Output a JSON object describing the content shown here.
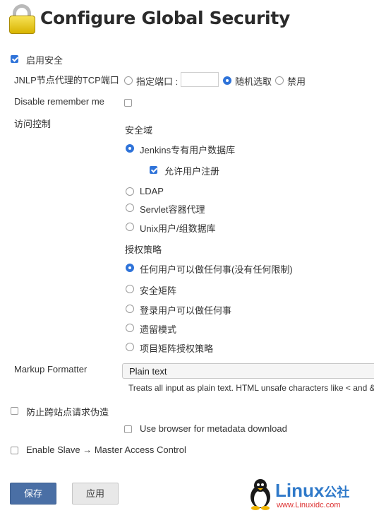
{
  "page": {
    "title": "Configure Global Security"
  },
  "enable_security": {
    "label": "启用安全",
    "checked": true
  },
  "jnlp": {
    "label": "JNLP节点代理的TCP端口",
    "options": [
      "指定端口 :",
      "随机选取",
      "禁用"
    ],
    "selected": "随机选取",
    "port_value": ""
  },
  "remember_me": {
    "label": "Disable remember me",
    "checked": false
  },
  "access_control": {
    "label": "访问控制",
    "realm": {
      "heading": "安全域",
      "options": [
        "Jenkins专有用户数据库",
        "LDAP",
        "Servlet容器代理",
        "Unix用户/组数据库"
      ],
      "selected": "Jenkins专有用户数据库",
      "allow_signup": {
        "label": "允许用户注册",
        "checked": true
      }
    },
    "authorization": {
      "heading": "授权策略",
      "options": [
        "任何用户可以做任何事(没有任何限制)",
        "安全矩阵",
        "登录用户可以做任何事",
        "遗留模式",
        "项目矩阵授权策略"
      ],
      "selected": "任何用户可以做任何事(没有任何限制)"
    }
  },
  "markup": {
    "label": "Markup Formatter",
    "value": "Plain text",
    "description": "Treats all input as plain text. HTML unsafe characters like < and &"
  },
  "csrf": {
    "label": "防止跨站点请求伪造",
    "checked": false
  },
  "metadata": {
    "label": "Use browser for metadata download",
    "checked": false
  },
  "slave_control": {
    "label": "Enable Slave → Master Access Control",
    "checked": false
  },
  "buttons": {
    "save": "保存",
    "apply": "应用"
  },
  "watermark": {
    "brand": "Linux",
    "suffix": "公社",
    "url": "www.Linuxidc.com"
  }
}
